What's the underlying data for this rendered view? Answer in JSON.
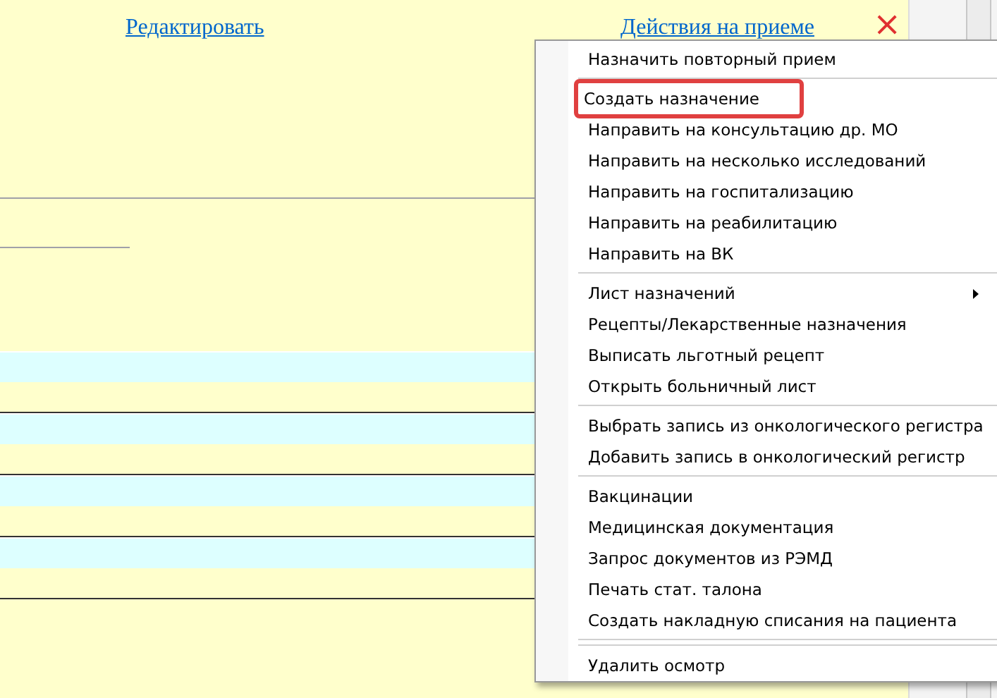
{
  "header": {
    "edit_link": "Редактировать",
    "actions_link": "Действия на приеме",
    "close": "×"
  },
  "rows": [
    {
      "kind": "cyan"
    },
    {
      "kind": "plain"
    },
    {
      "kind": "cyan"
    },
    {
      "kind": "plain"
    },
    {
      "kind": "cyan"
    },
    {
      "kind": "plain"
    },
    {
      "kind": "cyan"
    },
    {
      "kind": "plain"
    }
  ],
  "menu": [
    {
      "kind": "item",
      "label": "Назначить повторный прием",
      "highlighted": false
    },
    {
      "kind": "separator"
    },
    {
      "kind": "item",
      "label": "Создать назначение",
      "highlighted": true
    },
    {
      "kind": "item",
      "label": "Направить на консультацию др. МО",
      "highlighted": false
    },
    {
      "kind": "item",
      "label": "Направить на несколько исследований",
      "highlighted": false
    },
    {
      "kind": "item",
      "label": "Направить на госпитализацию",
      "highlighted": false
    },
    {
      "kind": "item",
      "label": "Направить на реабилитацию",
      "highlighted": false
    },
    {
      "kind": "item",
      "label": "Направить на ВК",
      "highlighted": false
    },
    {
      "kind": "separator"
    },
    {
      "kind": "item",
      "label": "Лист назначений",
      "highlighted": false,
      "submenu": true
    },
    {
      "kind": "item",
      "label": "Рецепты/Лекарственные назначения",
      "highlighted": false
    },
    {
      "kind": "item",
      "label": "Выписать льготный рецепт",
      "highlighted": false
    },
    {
      "kind": "item",
      "label": "Открыть больничный лист",
      "highlighted": false
    },
    {
      "kind": "separator"
    },
    {
      "kind": "item",
      "label": "Выбрать запись из онкологического регистра",
      "highlighted": false
    },
    {
      "kind": "item",
      "label": "Добавить запись в онкологический регистр",
      "highlighted": false
    },
    {
      "kind": "separator"
    },
    {
      "kind": "item",
      "label": "Вакцинации",
      "highlighted": false
    },
    {
      "kind": "item",
      "label": "Медицинская документация",
      "highlighted": false
    },
    {
      "kind": "item",
      "label": "Запрос документов из РЭМД",
      "highlighted": false
    },
    {
      "kind": "item",
      "label": "Печать стат. талона",
      "highlighted": false
    },
    {
      "kind": "item",
      "label": "Создать накладную списания на пациента",
      "highlighted": false
    },
    {
      "kind": "separator"
    },
    {
      "kind": "separator"
    },
    {
      "kind": "item",
      "label": "Удалить осмотр",
      "highlighted": false
    }
  ]
}
